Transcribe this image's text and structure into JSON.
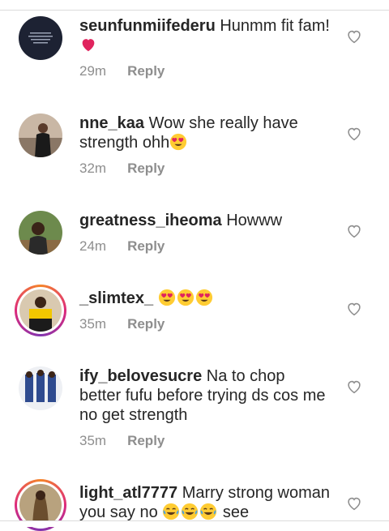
{
  "comments": [
    {
      "username": "seunfunmiifederu",
      "text": "Hunmm fit fam!",
      "time": "29m",
      "reply": "Reply"
    },
    {
      "username": "nne_kaa",
      "text": "Wow she really have strength ohh",
      "time": "32m",
      "reply": "Reply"
    },
    {
      "username": "greatness_iheoma",
      "text": "Howww",
      "time": "24m",
      "reply": "Reply"
    },
    {
      "username": "_slimtex_",
      "text": "",
      "time": "35m",
      "reply": "Reply"
    },
    {
      "username": "ify_belovesucre",
      "text": "Na to chop better fufu before trying ds cos me no get strength",
      "time": "35m",
      "reply": "Reply"
    },
    {
      "username": "light_atl7777",
      "text": "Marry strong woman you say no",
      "text_after": "see"
    }
  ],
  "icons": {
    "like": "heart-outline-icon",
    "emoji_love": "smiling-face-heart-eyes-icon",
    "emoji_laugh": "face-tears-of-joy-icon",
    "emoji_red_heart": "red-heart-icon"
  },
  "colors": {
    "text": "#262626",
    "meta": "#8e8e8e",
    "story_ring": "#dd2a7b",
    "red_heart": "#e0245e"
  }
}
